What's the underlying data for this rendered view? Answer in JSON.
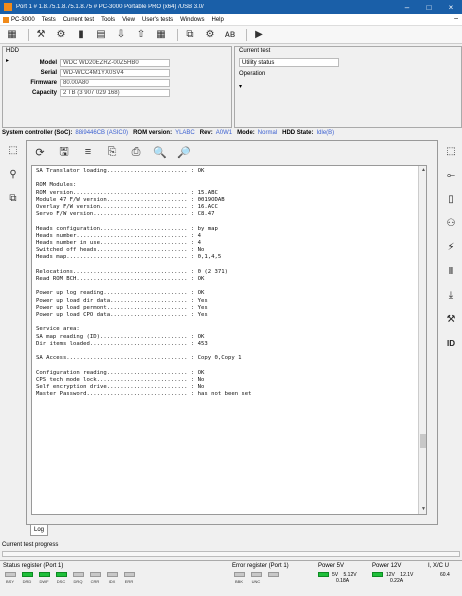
{
  "window": {
    "title": "Port 1 # 1.8.75.1.8.75.1.8.75 # PC-3000 Portable PRO (x64) /USB 3.0/",
    "min": "–",
    "max": "□",
    "close": "×"
  },
  "menu": {
    "items": [
      "PC-3000",
      "Tests",
      "Current test",
      "Tools",
      "View",
      "User's tests",
      "Windows",
      "Help"
    ],
    "minimize": "–"
  },
  "toolbar": {
    "icons": [
      "utility-icon",
      "tools-icon",
      "gear-icon",
      "drive-icon",
      "file-icon",
      "download-icon",
      "upload-icon",
      "table-icon",
      "copy-icon",
      "settings-icon",
      "abc-icon",
      "play-icon"
    ],
    "glyphs": [
      "▦",
      "⚒",
      "⚙",
      "▮",
      "▤",
      "⇩",
      "⇧",
      "▦",
      "⧉",
      "⚙",
      "ᴀʙ",
      "▶"
    ]
  },
  "hdd": {
    "title": "HDD",
    "fields": [
      {
        "label": "Model",
        "value": "WDC WD20EZRZ-00Z5HB0"
      },
      {
        "label": "Serial",
        "value": "WD-WCC4M1YX0SV4"
      },
      {
        "label": "Firmware",
        "value": "80.00A80"
      },
      {
        "label": "Capacity",
        "value": "2 TB (3 907 029 168)"
      }
    ]
  },
  "current_test": {
    "title": "Current test",
    "utility_status": "Utility status",
    "operation": "Operation"
  },
  "system": {
    "controller_label": "System controller (SoC):",
    "controller_value": "88i9446CB (ASIC0)",
    "rom_label": "ROM version:",
    "rom_value": "YLABC",
    "fw_label": "Rev:",
    "fw_value": "A0W1",
    "mode_label": "Mode:",
    "mode_value": "Normal",
    "hdd_state_label": "HDD State:",
    "hdd_state_value": "Idle(B)"
  },
  "left_tools": {
    "icons": [
      "map-icon",
      "profile-icon",
      "disk-tree-icon"
    ],
    "glyphs": [
      "⬚",
      "⚲",
      "⧉"
    ]
  },
  "right_tools": {
    "icons": [
      "map-icon",
      "cable-icon",
      "battery-icon",
      "robot-icon",
      "power-icon",
      "pause-icon",
      "head-icon",
      "tools-icon",
      "id-icon"
    ],
    "glyphs": [
      "⬚",
      "⟜",
      "▯",
      "⚇",
      "⚡",
      "Ⅱ",
      "⤓",
      "⚒",
      "ID"
    ]
  },
  "log_toolbar": {
    "icons": [
      "open-icon",
      "save-icon",
      "separator-icon",
      "copy-icon",
      "print-icon",
      "find-icon",
      "find-next-icon"
    ],
    "glyphs": [
      "⟳",
      "🖫",
      "≡",
      "⎘",
      "⎙",
      "🔍",
      "🔎"
    ]
  },
  "log": {
    "lines": [
      "SA Translator loading........................ : OK",
      "",
      "ROM Modules:",
      "ROM version.................................. : 15.ABC",
      "Module 47 F/W version........................ : 0019ODAB",
      "Overlay F/W version.......................... : 16.ACC",
      "Servo F/W version............................ : C8.47",
      "",
      "Heads configuration.......................... : by map",
      "Heads number................................. : 4",
      "Heads number in use.......................... : 4",
      "Switched off heads........................... : No",
      "Heads map.................................... : 0,1,4,5",
      "",
      "Relocations.................................. : 0 (2 371)",
      "Read ROM BCH................................. : OK",
      "",
      "Power up log reading......................... : OK",
      "Power up load dir data....................... : Yes",
      "Power up load permont........................ : Yes",
      "Power up load CPO data....................... : Yes",
      "",
      "Service area:",
      "SA map reading (ID).......................... : OK",
      "Dir items loaded............................. : 453",
      "",
      "SA Access.................................... : Copy 0,Copy 1",
      "",
      "Configuration reading........................ : OK",
      "CPS tech mode lock........................... : No",
      "Self encryption drive........................ : No",
      "Master Password.............................. : has not been set"
    ]
  },
  "log_tab": "Log",
  "progress_label": "Current test progress",
  "status_register": {
    "title": "Status register (Port 1)",
    "leds": [
      {
        "name": "BSY",
        "on": false
      },
      {
        "name": "DRD",
        "on": true
      },
      {
        "name": "DWF",
        "on": true
      },
      {
        "name": "DSC",
        "on": true
      },
      {
        "name": "DRQ",
        "on": false
      },
      {
        "name": "CRR",
        "on": false
      },
      {
        "name": "IDX",
        "on": false
      },
      {
        "name": "ERR",
        "on": false
      }
    ]
  },
  "error_register": {
    "title": "Error register (Port 1)",
    "leds": [
      {
        "name": "BBK",
        "on": false
      },
      {
        "name": "UNC",
        "on": false
      },
      {
        "name": "",
        "on": false
      }
    ]
  },
  "power5": {
    "title": "Power 5V",
    "value1": "5V",
    "value2": "5.12V",
    "value3": "0.18A"
  },
  "power12": {
    "title": "Power 12V",
    "value1": "12V",
    "value2": "12.1V",
    "value3": "0.22A"
  },
  "cpu": {
    "title": "I, X/C U",
    "value": "60.4"
  }
}
